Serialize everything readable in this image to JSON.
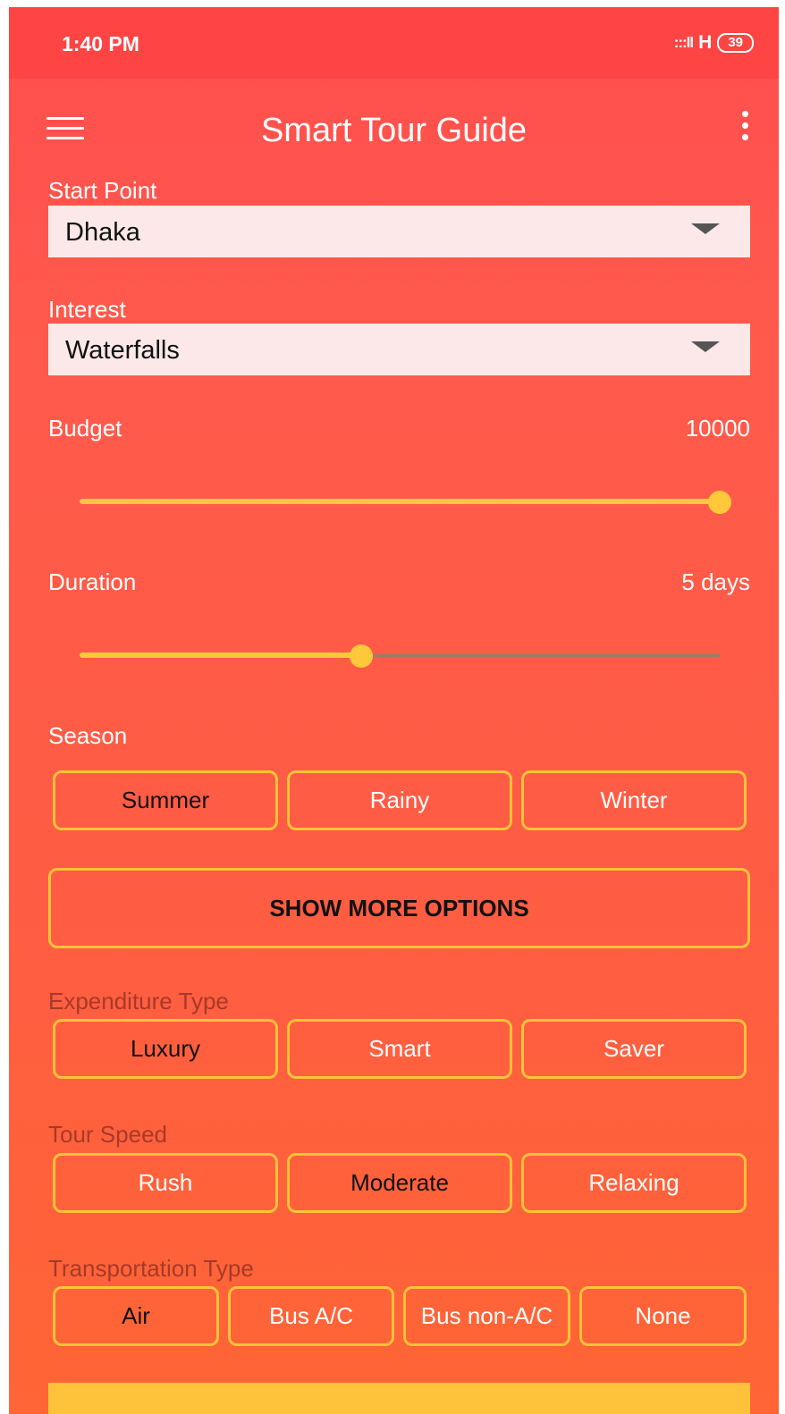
{
  "status": {
    "time": "1:40 PM",
    "signal": ":::ll",
    "network": "H",
    "battery": "39"
  },
  "toolbar": {
    "title": "Smart Tour Guide"
  },
  "start_point": {
    "label": "Start Point",
    "value": "Dhaka"
  },
  "interest": {
    "label": "Interest",
    "value": "Waterfalls"
  },
  "budget": {
    "label": "Budget",
    "value": "10000",
    "slider_fraction": 1.0
  },
  "duration": {
    "label": "Duration",
    "value": "5 days",
    "slider_fraction": 0.44
  },
  "season": {
    "label": "Season",
    "options": [
      "Summer",
      "Rainy",
      "Winter"
    ],
    "selected": "Summer"
  },
  "show_more": {
    "label": "SHOW MORE OPTIONS"
  },
  "expenditure": {
    "label": "Expenditure Type",
    "options": [
      "Luxury",
      "Smart",
      "Saver"
    ],
    "selected": "Luxury"
  },
  "tour_speed": {
    "label": "Tour Speed",
    "options": [
      "Rush",
      "Moderate",
      "Relaxing"
    ],
    "selected": "Moderate"
  },
  "transportation": {
    "label": "Transportation Type",
    "options": [
      "Air",
      "Bus A/C",
      "Bus non-A/C",
      "None"
    ],
    "selected": "Air"
  },
  "colors": {
    "accent": "#ffc23a",
    "background_top": "#ff4e4e",
    "background_bottom": "#ff6535",
    "dropdown_bg": "#fce8e8"
  }
}
